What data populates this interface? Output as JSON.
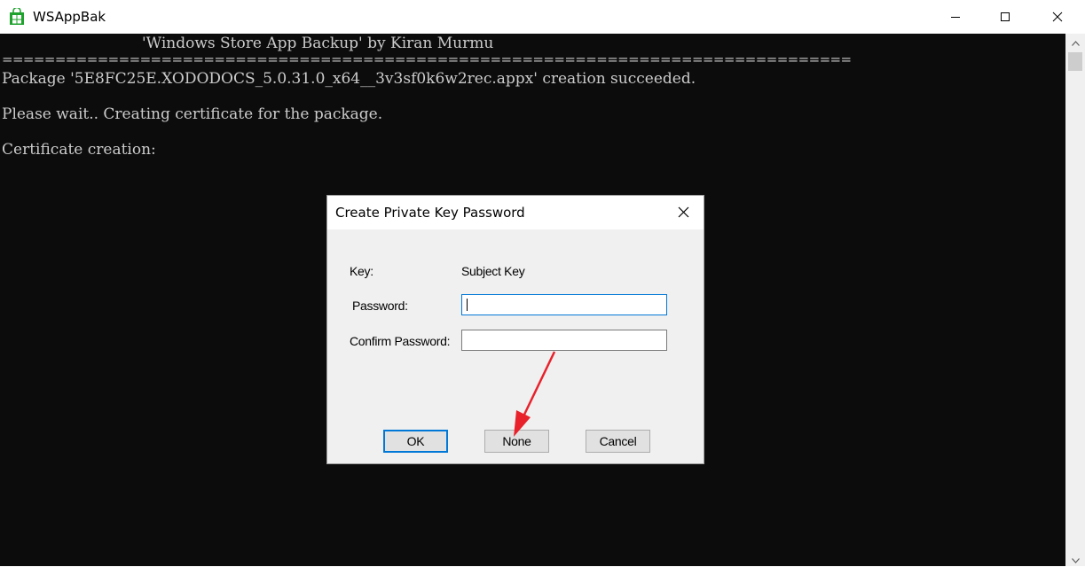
{
  "window": {
    "title": "WSAppBak"
  },
  "console": {
    "lines": [
      "'Windows Store App Backup' by Kiran Murmu",
      "================================================================================",
      "Package '5E8FC25E.XODODOCS_5.0.31.0_x64__3v3sf0k6w2rec.appx' creation succeeded.",
      "Please wait.. Creating certificate for the package.",
      "Certificate creation:"
    ]
  },
  "dialog": {
    "title": "Create Private Key Password",
    "key_label": "Key:",
    "key_value": "Subject Key",
    "password_label": "Password:",
    "password_value": "",
    "confirm_label": "Confirm Password:",
    "confirm_value": "",
    "ok_label": "OK",
    "none_label": "None",
    "cancel_label": "Cancel"
  },
  "colors": {
    "console_bg": "#0c0c0c",
    "console_text": "#cccccc",
    "focus_blue": "#0078d7",
    "annotation_arrow": "#e8212b",
    "app_icon": "#1fa22e"
  },
  "icons": {
    "app": "store-bag-icon",
    "minimize": "minimize-icon",
    "maximize": "maximize-icon",
    "close": "close-icon",
    "dialog_close": "close-icon"
  }
}
